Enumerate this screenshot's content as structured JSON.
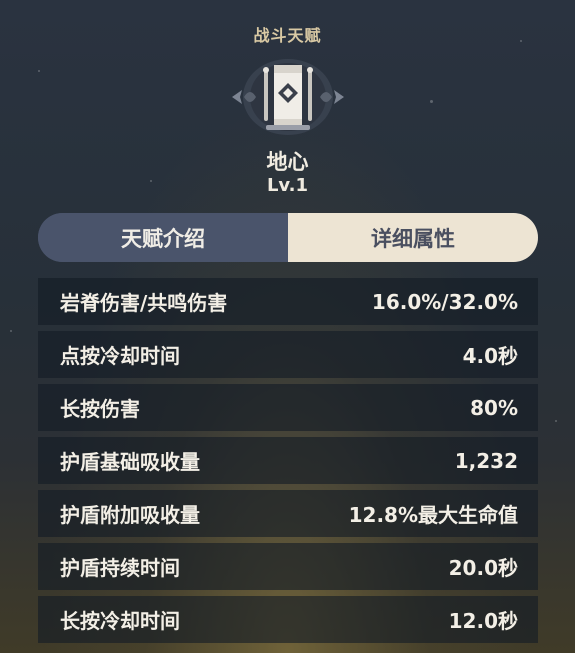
{
  "header": {
    "section_title": "战斗天赋",
    "emblem_icon": "talent-emblem-icon",
    "talent_name": "地心",
    "level": "Lv.1"
  },
  "tabs": [
    {
      "label": "天赋介绍",
      "active": false
    },
    {
      "label": "详细属性",
      "active": true
    }
  ],
  "attributes": [
    {
      "label": "岩脊伤害/共鸣伤害",
      "value": "16.0%/32.0%"
    },
    {
      "label": "点按冷却时间",
      "value": "4.0秒"
    },
    {
      "label": "长按伤害",
      "value": "80%"
    },
    {
      "label": "护盾基础吸收量",
      "value": "1,232"
    },
    {
      "label": "护盾附加吸收量",
      "value": "12.8%最大生命值"
    },
    {
      "label": "护盾持续时间",
      "value": "20.0秒"
    },
    {
      "label": "长按冷却时间",
      "value": "12.0秒"
    }
  ],
  "colors": {
    "accent_gold": "#d9c9a4",
    "active_tab_bg": "#ede4d3",
    "inactive_tab_bg": "#4a546b",
    "row_bg": "#141b25"
  }
}
